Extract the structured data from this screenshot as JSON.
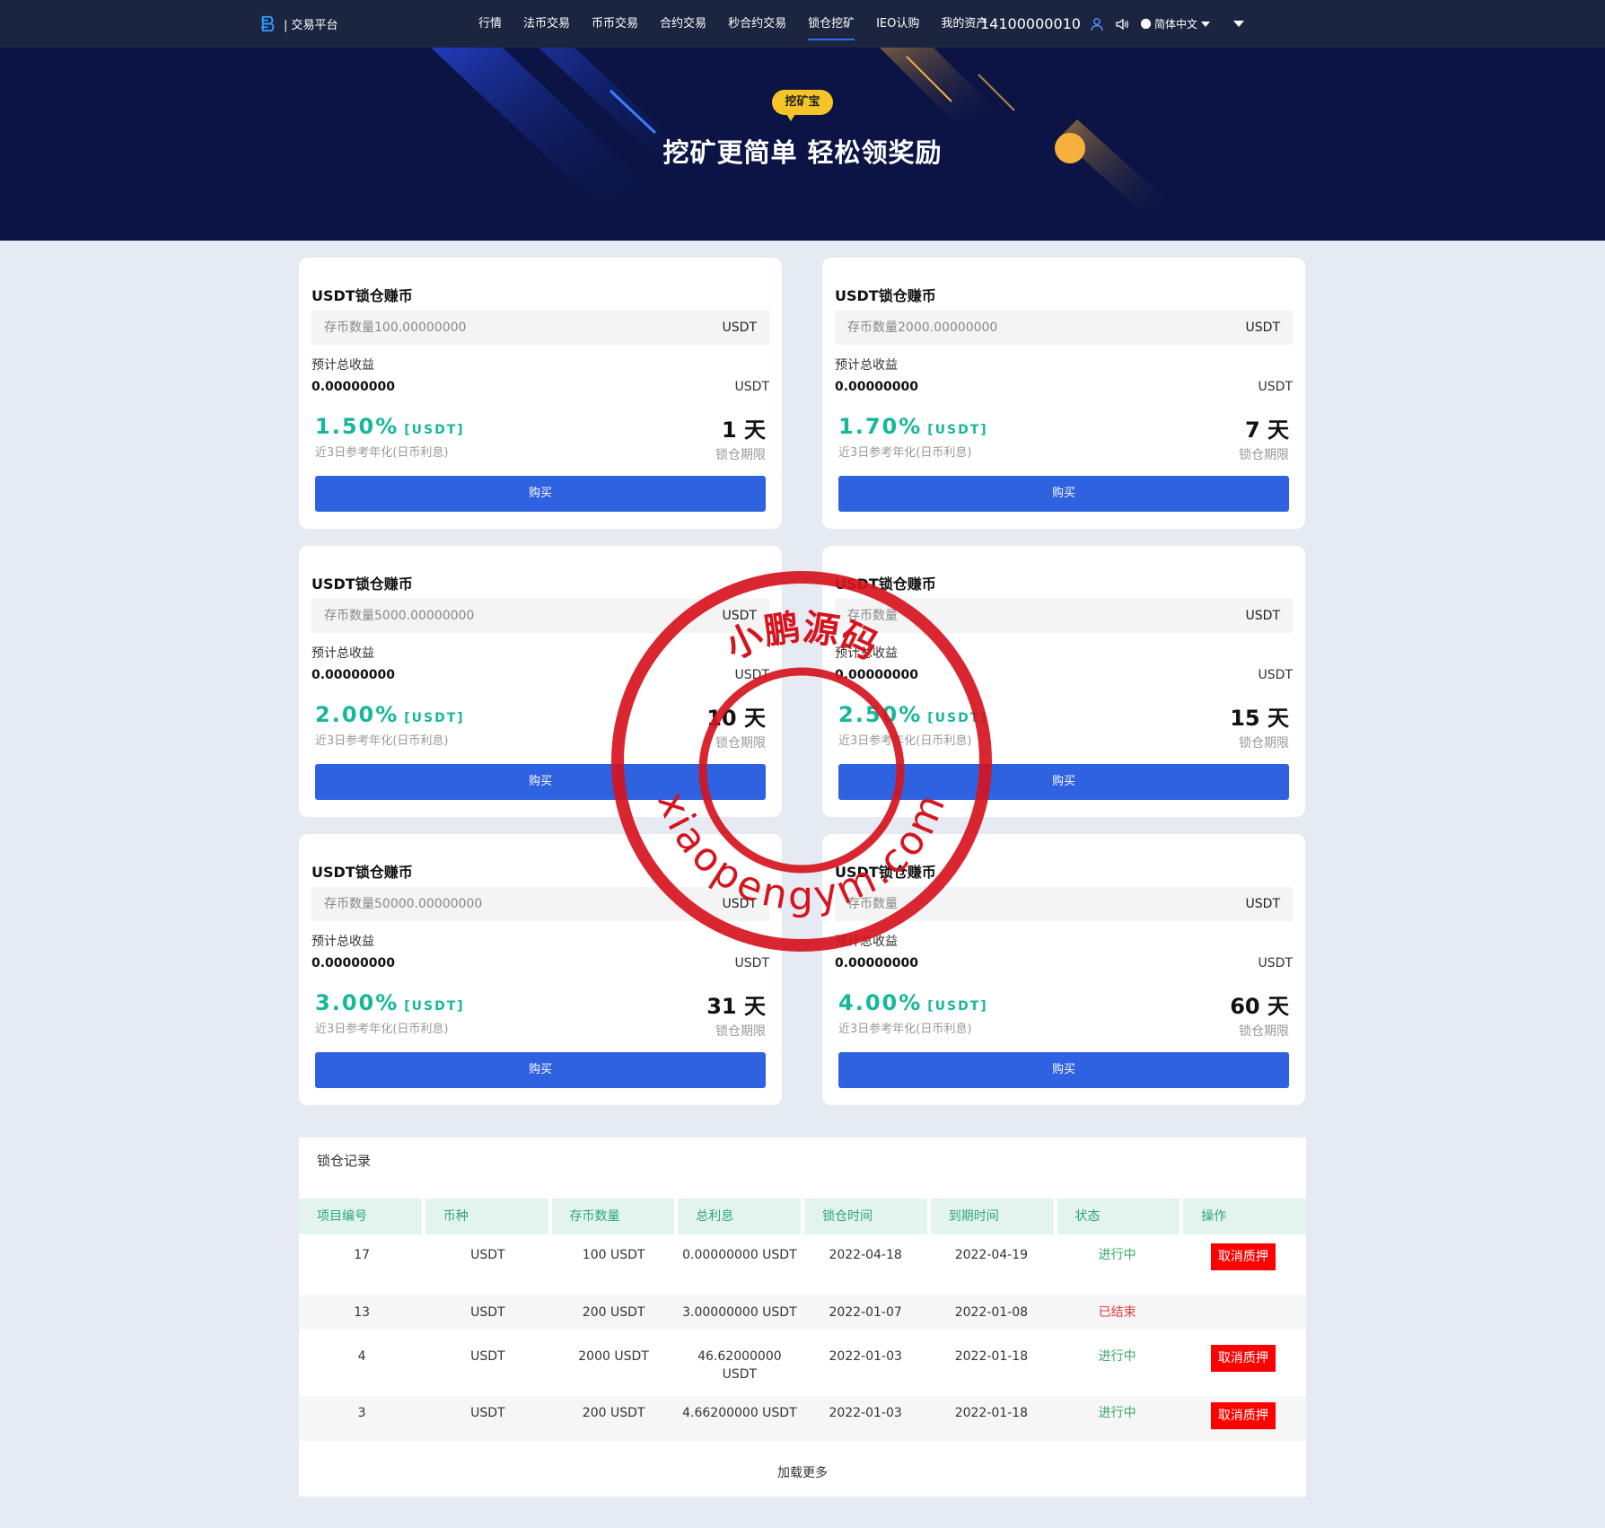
{
  "brand": {
    "name": "| 交易平台"
  },
  "nav": {
    "items": [
      "行情",
      "法币交易",
      "币币交易",
      "合约交易",
      "秒合约交易",
      "锁仓挖矿",
      "IEO认购",
      "我的资产"
    ],
    "active_index": 5,
    "account": "14100000010",
    "language": "简体中文"
  },
  "hero": {
    "badge": "挖矿宝",
    "title": "挖矿更简单 轻松领奖励"
  },
  "cards": [
    {
      "title": "USDT锁仓赚币",
      "input_placeholder": "存币数量100.00000000",
      "input_unit": "USDT",
      "income_label": "预计总收益",
      "income_value": "0.00000000",
      "income_unit": "USDT",
      "rate": "1.50%",
      "rate_tag": "[USDT]",
      "rate_note": "近3日参考年化(日币利息)",
      "days": "1 天",
      "days_note": "锁仓期限",
      "button": "购买"
    },
    {
      "title": "USDT锁仓赚币",
      "input_placeholder": "存币数量2000.00000000",
      "input_unit": "USDT",
      "income_label": "预计总收益",
      "income_value": "0.00000000",
      "income_unit": "USDT",
      "rate": "1.70%",
      "rate_tag": "[USDT]",
      "rate_note": "近3日参考年化(日币利息)",
      "days": "7 天",
      "days_note": "锁仓期限",
      "button": "购买"
    },
    {
      "title": "USDT锁仓赚币",
      "input_placeholder": "存币数量5000.00000000",
      "input_unit": "USDT",
      "income_label": "预计总收益",
      "income_value": "0.00000000",
      "income_unit": "USDT",
      "rate": "2.00%",
      "rate_tag": "[USDT]",
      "rate_note": "近3日参考年化(日币利息)",
      "days": "10 天",
      "days_note": "锁仓期限",
      "button": "购买"
    },
    {
      "title": "USDT锁仓赚币",
      "input_placeholder": "存币数量",
      "input_unit": "USDT",
      "income_label": "预计总收益",
      "income_value": "0.00000000",
      "income_unit": "USDT",
      "rate": "2.50%",
      "rate_tag": "[USDT]",
      "rate_note": "近3日参考年化(日币利息)",
      "days": "15 天",
      "days_note": "锁仓期限",
      "button": "购买"
    },
    {
      "title": "USDT锁仓赚币",
      "input_placeholder": "存币数量50000.00000000",
      "input_unit": "USDT",
      "income_label": "预计总收益",
      "income_value": "0.00000000",
      "income_unit": "USDT",
      "rate": "3.00%",
      "rate_tag": "[USDT]",
      "rate_note": "近3日参考年化(日币利息)",
      "days": "31 天",
      "days_note": "锁仓期限",
      "button": "购买"
    },
    {
      "title": "USDT锁仓赚币",
      "input_placeholder": "存币数量",
      "input_unit": "USDT",
      "income_label": "预计总收益",
      "income_value": "0.00000000",
      "income_unit": "USDT",
      "rate": "4.00%",
      "rate_tag": "[USDT]",
      "rate_note": "近3日参考年化(日币利息)",
      "days": "60 天",
      "days_note": "锁仓期限",
      "button": "购买"
    }
  ],
  "records": {
    "title": "锁仓记录",
    "columns": [
      "项目编号",
      "币种",
      "存币数量",
      "总利息",
      "锁仓时间",
      "到期时间",
      "状态",
      "操作"
    ],
    "rows": [
      {
        "id": "17",
        "coin": "USDT",
        "amount": "100 USDT",
        "interest": "0.00000000 USDT",
        "start": "2022-04-18",
        "end": "2022-04-19",
        "status": "进行中",
        "status_kind": "on",
        "action": "取消质押"
      },
      {
        "id": "13",
        "coin": "USDT",
        "amount": "200 USDT",
        "interest": "3.00000000 USDT",
        "start": "2022-01-07",
        "end": "2022-01-08",
        "status": "已结束",
        "status_kind": "off",
        "action": ""
      },
      {
        "id": "4",
        "coin": "USDT",
        "amount": "2000 USDT",
        "interest": "46.62000000 USDT",
        "start": "2022-01-03",
        "end": "2022-01-18",
        "status": "进行中",
        "status_kind": "on",
        "action": "取消质押"
      },
      {
        "id": "3",
        "coin": "USDT",
        "amount": "200 USDT",
        "interest": "4.66200000 USDT",
        "start": "2022-01-03",
        "end": "2022-01-18",
        "status": "进行中",
        "status_kind": "on",
        "action": "取消质押"
      }
    ],
    "load_more": "加载更多"
  },
  "watermark": {
    "text_top": "小鹏源码",
    "text_bottom": "xiaopengym.com"
  },
  "colors": {
    "nav_bg": "#1b2540",
    "hero_bg": "#0b1445",
    "accent": "#2f62e0",
    "rate": "#16b89a",
    "danger": "#ff0000",
    "page_bg": "#e6ebf3"
  },
  "icons": {
    "brand": "brand-logo-icon",
    "user": "user-icon",
    "speaker": "speaker-icon",
    "globe": "globe-icon"
  }
}
